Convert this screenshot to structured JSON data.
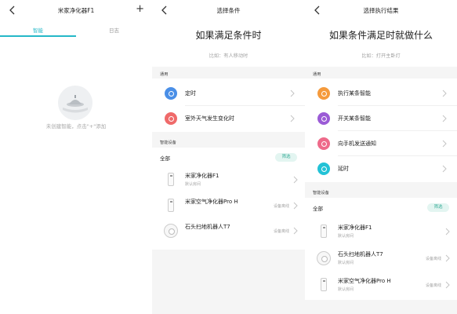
{
  "pane1": {
    "title": "米家净化器F1",
    "plus": "+",
    "tabs": [
      "智能",
      "日志"
    ],
    "empty_text": "未创建智能，点击\"+\"添加"
  },
  "pane2": {
    "title": "选择条件",
    "heading": "如果满足条件时",
    "subheading": "比如：有人移动时",
    "section_general": "通用",
    "general_items": [
      {
        "label": "定时",
        "color": "#4a8fe7"
      },
      {
        "label": "室外天气发生变化时",
        "color": "#ef6a6a"
      }
    ],
    "section_devices": "智能设备",
    "all_label": "全部",
    "filter_label": "筛选",
    "devices": [
      {
        "name": "米家净化器F1",
        "room": "默认房间",
        "status": ""
      },
      {
        "name": "米家空气净化器Pro H",
        "room": "",
        "status": "设备离线"
      },
      {
        "name": "石头扫地机器人T7",
        "room": "",
        "status": "设备离线"
      }
    ]
  },
  "pane3": {
    "title": "选择执行结果",
    "heading": "如果条件满足时就做什么",
    "subheading": "比如：打开主卧灯",
    "section_general": "通用",
    "general_items": [
      {
        "label": "执行某条智能",
        "color": "#f59a3c"
      },
      {
        "label": "开关某条智能",
        "color": "#9b5bd6"
      },
      {
        "label": "向手机发送通知",
        "color": "#ee6a8a"
      },
      {
        "label": "延时",
        "color": "#22c2d6"
      }
    ],
    "section_devices": "智能设备",
    "all_label": "全部",
    "filter_label": "筛选",
    "devices": [
      {
        "name": "米家净化器F1",
        "room": "默认房间",
        "status": ""
      },
      {
        "name": "石头扫地机器人T7",
        "room": "默认房间",
        "status": "设备离线"
      },
      {
        "name": "米家空气净化器Pro H",
        "room": "默认房间",
        "status": "设备离线"
      }
    ]
  },
  "colors": {
    "accent": "#25b8c8",
    "filter_bg": "#e3f5f1",
    "filter_text": "#3cae9a"
  }
}
